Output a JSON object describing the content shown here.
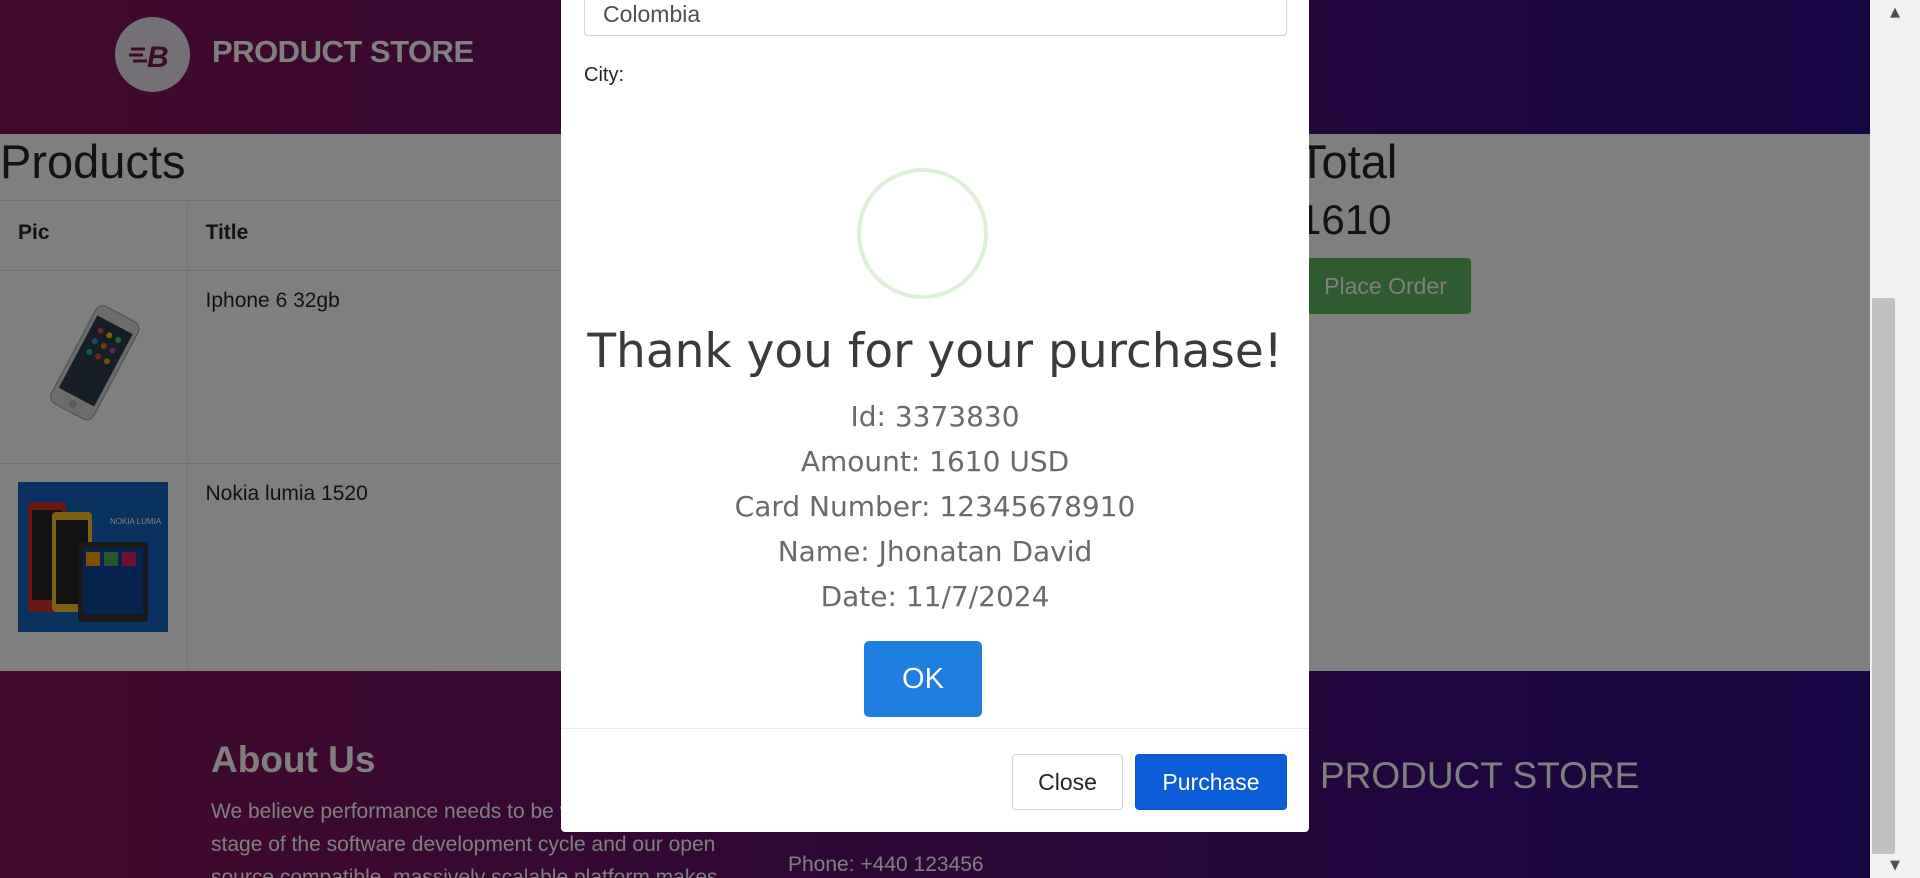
{
  "header": {
    "brand": "PRODUCT STORE"
  },
  "cart": {
    "title": "Products",
    "columns": [
      "Pic",
      "Title"
    ],
    "rows": [
      {
        "title": "Iphone 6 32gb"
      },
      {
        "title": "Nokia lumia 1520"
      }
    ],
    "total_title": "Total",
    "total_value": "1610",
    "place_order_label": "Place Order"
  },
  "order_modal": {
    "country_value": "Colombia",
    "city_label": "City:",
    "close_label": "Close",
    "purchase_label": "Purchase"
  },
  "alert": {
    "title": "Thank you for your purchase!",
    "lines": [
      "Id: 3373830",
      "Amount: 1610 USD",
      "Card Number: 12345678910",
      "Name: Jhonatan David",
      "Date: 11/7/2024"
    ],
    "ok_label": "OK"
  },
  "footer": {
    "about_title": "About Us",
    "about_text": "We believe performance needs to be validated at every stage of the software development cycle and our open source compatible, massively scalable platform makes",
    "phone": "Phone: +440 123456",
    "brand": "PRODUCT STORE"
  },
  "colors": {
    "accent": "#1e7fe0",
    "success": "#5cb85c",
    "header_gradient_start": "#8a1158",
    "header_gradient_end": "#2a0b86"
  }
}
